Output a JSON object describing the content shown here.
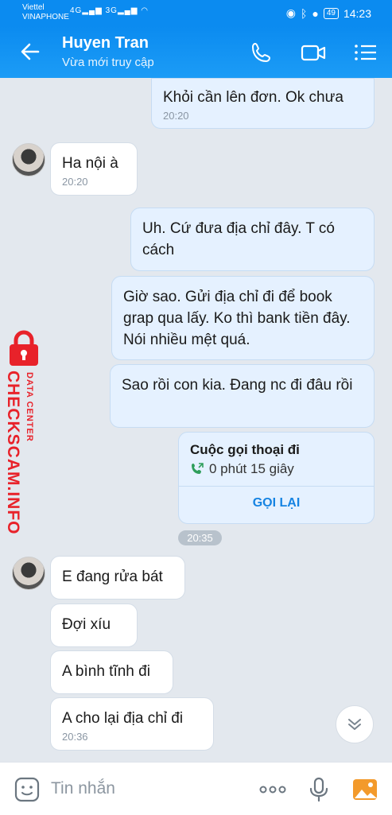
{
  "status_bar": {
    "carrier_1": "Viettel",
    "carrier_2": "VINAPHONE",
    "network_1": "4G",
    "network_2": "3G",
    "battery": "49",
    "time": "14:23"
  },
  "header": {
    "contact_name": "Huyen Tran",
    "status": "Vừa mới truy cập",
    "icons": [
      "back-arrow-icon",
      "phone-icon",
      "video-call-icon",
      "menu-list-icon"
    ]
  },
  "messages": [
    {
      "from": "me",
      "text": "Khỏi cần lên đơn. Ok chưa",
      "time": "20:20"
    },
    {
      "from": "them",
      "text": "Ha nội à",
      "time": "20:20"
    },
    {
      "from": "me",
      "text": "Uh. Cứ đưa địa chỉ đây. T có cách"
    },
    {
      "from": "me",
      "text": "Giờ sao. Gửi địa chỉ đi để book grap qua lấy. Ko thì bank tiền đây. Nói nhiều mệt quá."
    },
    {
      "from": "me",
      "text": "Sao rồi con kia. Đang nc đi đâu rồi"
    },
    {
      "from": "them",
      "text": "E đang rửa bát"
    },
    {
      "from": "them",
      "text": "Đợi xíu"
    },
    {
      "from": "them",
      "text": "A bình tĩnh đi"
    },
    {
      "from": "them",
      "text": "A cho lại địa chỉ đi",
      "time": "20:36"
    }
  ],
  "call_card": {
    "title": "Cuộc gọi thoại đi",
    "duration": "0 phút 15 giây",
    "action": "GỌI LẠI"
  },
  "time_separator": "20:35",
  "watermark": {
    "small": "DATA CENTER",
    "big": "CHECKSCAM.INFO"
  },
  "input": {
    "placeholder": "Tin nhắn",
    "icons": [
      "sticker-icon",
      "more-icon",
      "microphone-icon",
      "gallery-icon"
    ]
  },
  "colors": {
    "header": "#0b8bf0",
    "my_bubble": "#e5f1ff",
    "their_bubble": "#ffffff",
    "chat_background": "#e3e8ee",
    "accent": "#1583e2",
    "watermark": "#e8222a"
  }
}
